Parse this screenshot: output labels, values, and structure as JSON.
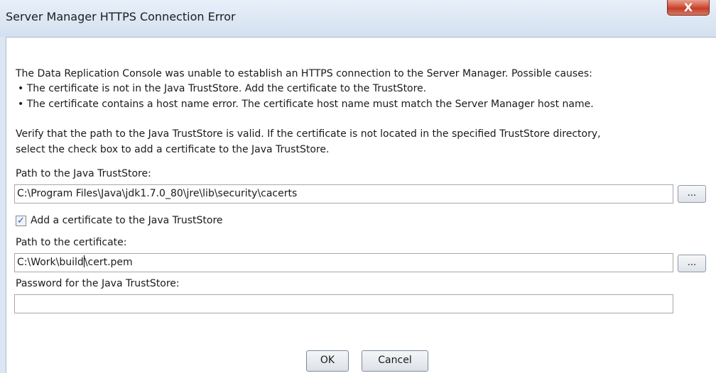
{
  "window": {
    "title": "Server Manager HTTPS Connection Error",
    "close_label": "X"
  },
  "message": {
    "intro": "The Data Replication Console was unable to establish an HTTPS connection to the Server Manager. Possible causes:",
    "causes": [
      "• The certificate is not in the Java TrustStore. Add the certificate to the TrustStore.",
      "• The certificate contains a host name error. The certificate host name must match the Server Manager host name."
    ],
    "verify_line1": "Verify that the path to the Java TrustStore is valid. If the certificate is not located in the specified TrustStore directory,",
    "verify_line2": "select the check box to add a certificate to the Java TrustStore."
  },
  "truststore": {
    "label": "Path to the Java TrustStore:",
    "value": "C:\\Program Files\\Java\\jdk1.7.0_80\\jre\\lib\\security\\cacerts",
    "browse_label": "..."
  },
  "add_cert": {
    "label": "Add a certificate to the Java TrustStore",
    "checked": true,
    "check_glyph": "✓"
  },
  "certificate": {
    "label": "Path to the certificate:",
    "value_before_caret": "C:\\Work\\build",
    "value_after_caret": "\\cert.pem",
    "browse_label": "..."
  },
  "password": {
    "label": "Password for the Java TrustStore:",
    "value": ""
  },
  "buttons": {
    "ok": "OK",
    "cancel": "Cancel"
  },
  "colors": {
    "titlebar": "#dbe6f2",
    "close_button": "#c7432f",
    "checkbox_mark": "#2b55b8"
  }
}
